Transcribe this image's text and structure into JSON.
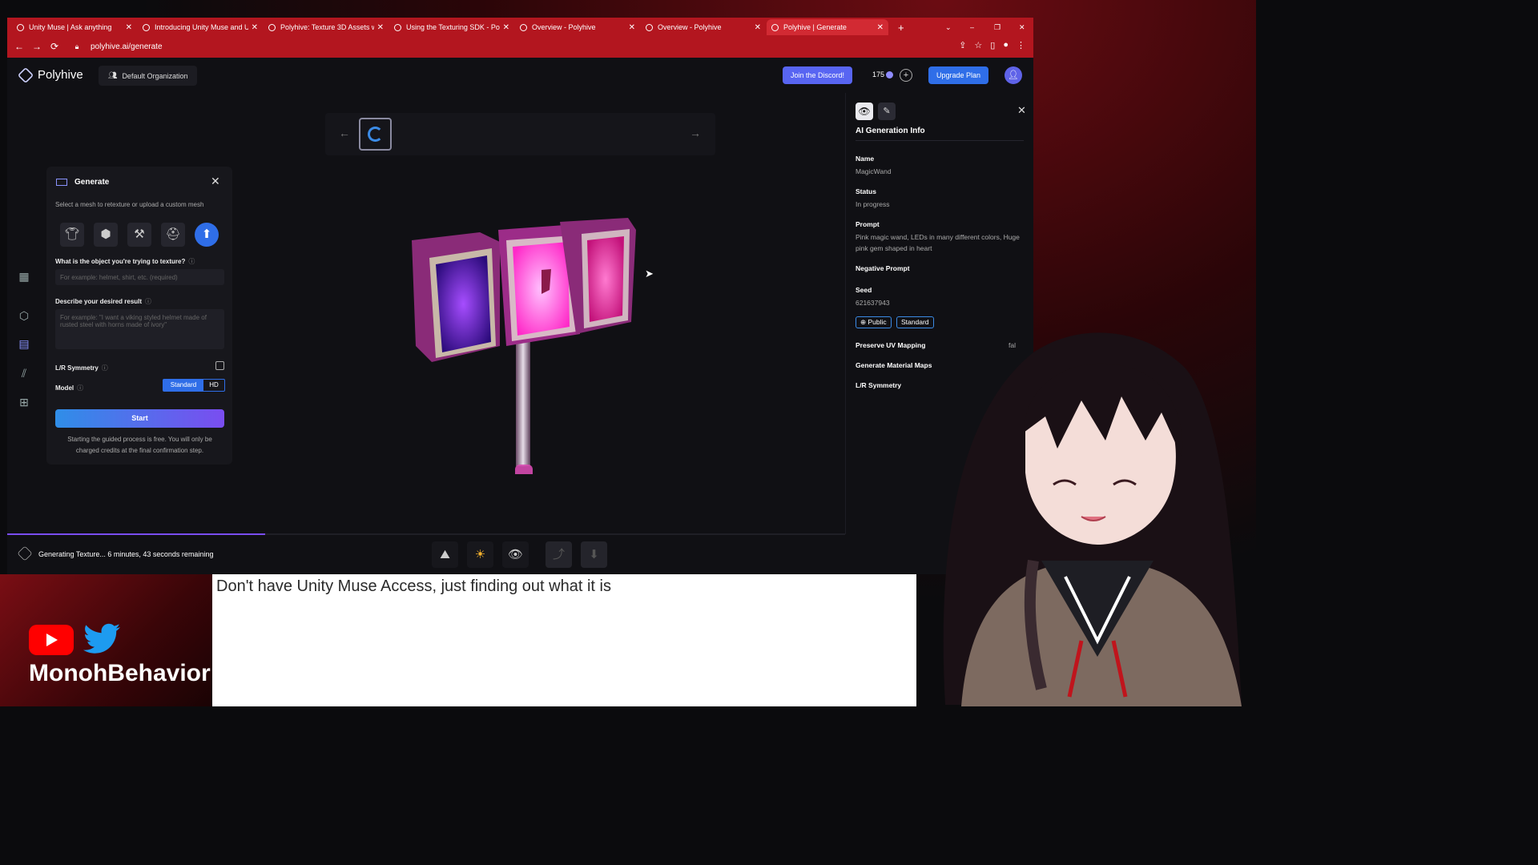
{
  "browser": {
    "tabs": [
      {
        "title": "Unity Muse | Ask anything",
        "active": false
      },
      {
        "title": "Introducing Unity Muse and Ur",
        "active": false
      },
      {
        "title": "Polyhive: Texture 3D Assets wit",
        "active": false
      },
      {
        "title": "Using the Texturing SDK - Poly",
        "active": false
      },
      {
        "title": "Overview - Polyhive",
        "active": false
      },
      {
        "title": "Overview - Polyhive",
        "active": false
      },
      {
        "title": "Polyhive | Generate",
        "active": true
      }
    ],
    "new_tab": "+",
    "url": "polyhive.ai/generate"
  },
  "header": {
    "app_name": "Polyhive",
    "org": "Default Organization",
    "discord_label": "Join the Discord!",
    "credits": "175",
    "upgrade_label": "Upgrade Plan"
  },
  "generate_panel": {
    "title": "Generate",
    "subtitle": "Select a mesh to retexture or upload a custom mesh",
    "object_label": "What is the object you're trying to texture?",
    "object_placeholder": "For example: helmet, shirt, etc. (required)",
    "describe_label": "Describe your desired result",
    "describe_placeholder": "For example: \"I want a viking styled helmet made of rusted steel with horns made of ivory\"",
    "symmetry_label": "L/R Symmetry",
    "model_label": "Model",
    "model_options": [
      "Standard",
      "HD"
    ],
    "model_selected": "Standard",
    "start_label": "Start",
    "footnote": "Starting the guided process is free. You will only be charged credits at the final confirmation step."
  },
  "info_panel": {
    "title": "AI Generation Info",
    "fields": [
      {
        "key": "Name",
        "value": "MagicWand"
      },
      {
        "key": "Status",
        "value": "In progress"
      },
      {
        "key": "Prompt",
        "value": "Pink magic wand, LEDs in many different colors, Huge pink gem shaped in heart"
      },
      {
        "key": "Negative Prompt",
        "value": ""
      },
      {
        "key": "Seed",
        "value": "621637943"
      }
    ],
    "badges": [
      "Public",
      "Standard"
    ],
    "preserve_uv": "Preserve UV Mapping",
    "preserve_uv_value": "fal",
    "material_maps": "Generate Material Maps",
    "symmetry": "L/R Symmetry"
  },
  "status": {
    "text": "Generating Texture... 6 minutes, 43 seconds remaining",
    "progress": 0.308
  },
  "overlay": {
    "caption": "Don't have Unity Muse Access, just finding out what it is",
    "channel": "MonohBehavior"
  },
  "colors": {
    "browser_red": "#b3161f",
    "accent_blue": "#2f6ee8",
    "discord": "#5865f2",
    "progress": "#7a4df0"
  }
}
